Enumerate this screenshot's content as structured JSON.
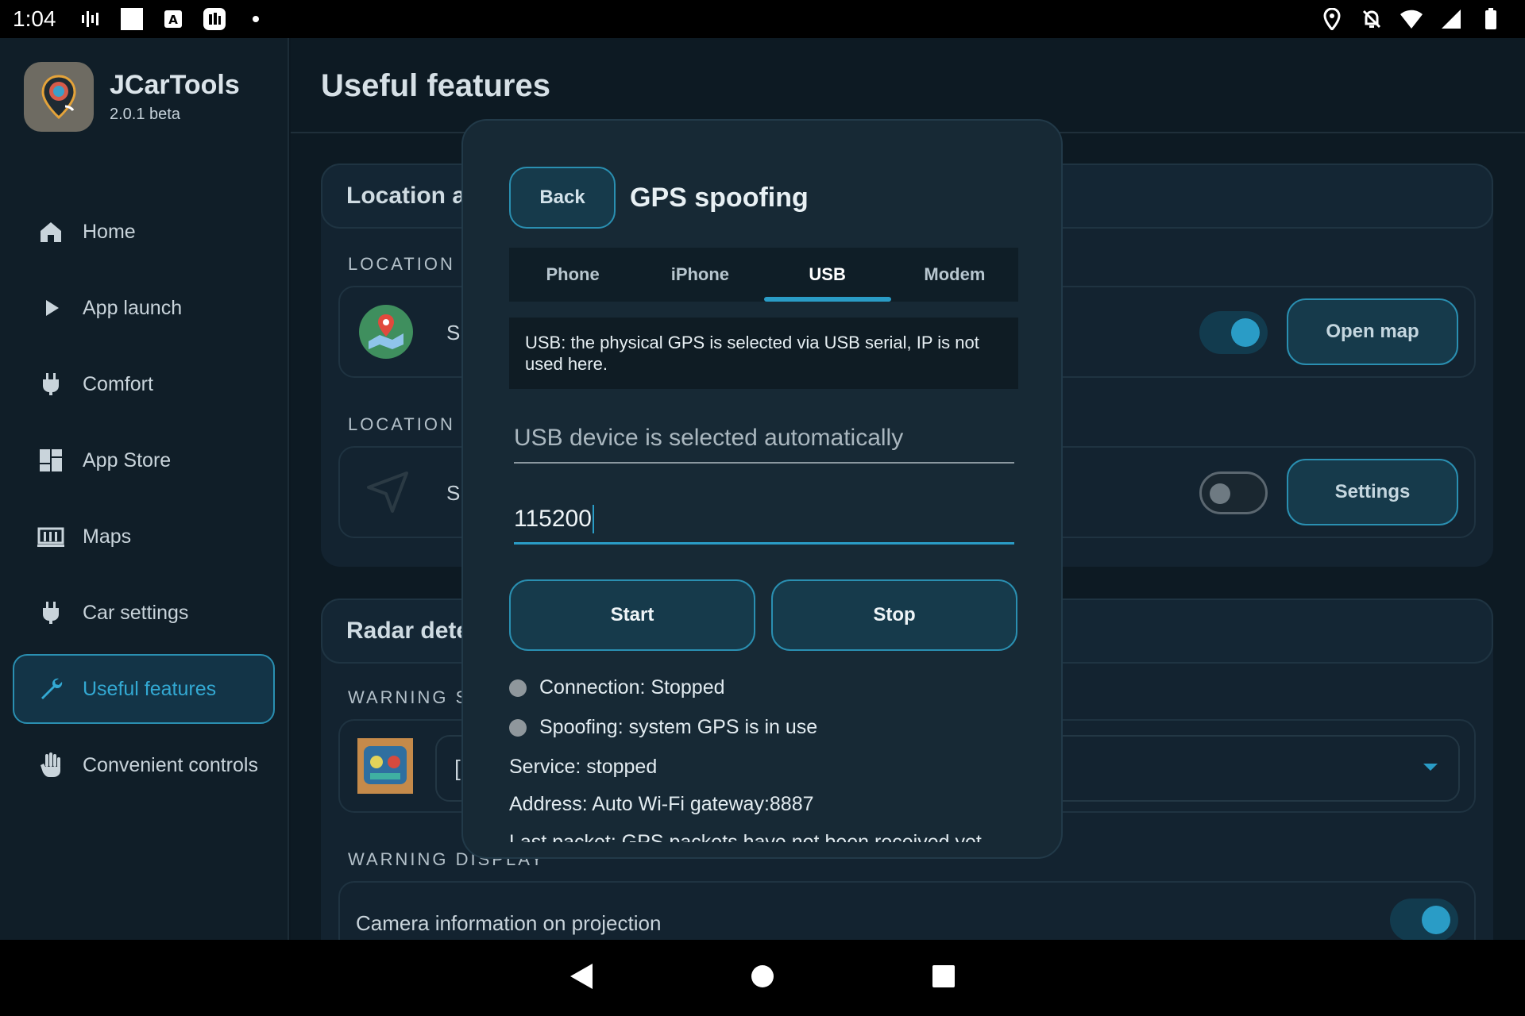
{
  "status_bar": {
    "time": "1:04"
  },
  "app": {
    "name": "JCarTools",
    "version": "2.0.1 beta"
  },
  "nav": {
    "items": [
      {
        "label": "Home",
        "icon": "home-icon"
      },
      {
        "label": "App launch",
        "icon": "play-icon"
      },
      {
        "label": "Comfort",
        "icon": "plug-icon"
      },
      {
        "label": "App Store",
        "icon": "dashboard-icon"
      },
      {
        "label": "Maps",
        "icon": "map-icon"
      },
      {
        "label": "Car settings",
        "icon": "plug-icon"
      },
      {
        "label": "Useful features",
        "icon": "wrench-icon",
        "active": true
      },
      {
        "label": "Convenient controls",
        "icon": "hand-icon"
      }
    ]
  },
  "main": {
    "title": "Useful features",
    "location_card": {
      "title": "Location ar",
      "section1_label": "LOCATION S",
      "row1_text": "S",
      "open_map_label": "Open map",
      "section2_label": "LOCATION S",
      "row2_text": "S",
      "settings_label": "Settings"
    },
    "radar_card": {
      "title": "Radar dete",
      "section1_label": "WARNING S(",
      "dropdown_text": "[",
      "section2_label": "WARNING DISPLAY",
      "camera_row_text": "Camera information on projection"
    }
  },
  "dialog": {
    "back_label": "Back",
    "title": "GPS spoofing",
    "tabs": [
      "Phone",
      "iPhone",
      "USB",
      "Modem"
    ],
    "active_tab": "USB",
    "info": "USB: the physical GPS is selected via USB serial, IP is not used here.",
    "usb_device_placeholder": "USB device is selected automatically",
    "baud_value": "115200",
    "start_label": "Start",
    "stop_label": "Stop",
    "connection_status": "Connection: Stopped",
    "spoofing_status": "Spoofing: system GPS is in use",
    "service_status": "Service: stopped",
    "address": "Address: Auto Wi-Fi gateway:8887",
    "last_packet": "Last packet: GPS packets have not been received yet"
  },
  "colors": {
    "accent": "#2a9cc6",
    "background": "#0d1a23",
    "dialog_background": "#172935"
  }
}
